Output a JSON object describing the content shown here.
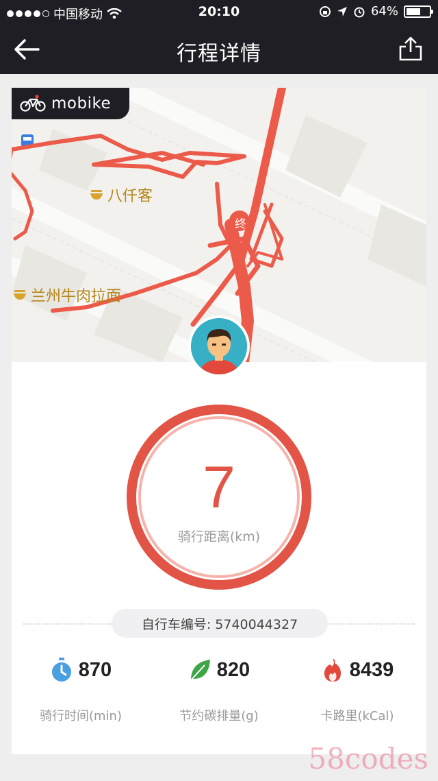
{
  "status_bar": {
    "carrier": "中国移动",
    "time": "20:10",
    "battery_percent": "64%",
    "battery_level": 0.64
  },
  "nav": {
    "title": "行程详情",
    "back_icon": "back-arrow-icon",
    "share_icon": "share-icon"
  },
  "map": {
    "logo_text": "mobike",
    "pois": [
      {
        "name": "八仟客"
      },
      {
        "name": "兰州牛肉拉面"
      }
    ],
    "end_marker": "终"
  },
  "ride": {
    "distance_value": "7",
    "distance_label": "骑行距离(km)",
    "bike_number_label": "自行车编号: 5740044327"
  },
  "stats": [
    {
      "icon": "stopwatch-icon",
      "value": "870",
      "label": "骑行时间(min)",
      "color": "#4a9fe0"
    },
    {
      "icon": "leaf-icon",
      "value": "820",
      "label": "节约碳排量(g)",
      "color": "#3fa548"
    },
    {
      "icon": "flame-icon",
      "value": "8439",
      "label": "卡路里(kCal)",
      "color": "#e2483b"
    }
  ],
  "watermark": "58codes",
  "colors": {
    "accent": "#e25445",
    "header": "#1e1e24",
    "route": "#ec5a4a"
  }
}
